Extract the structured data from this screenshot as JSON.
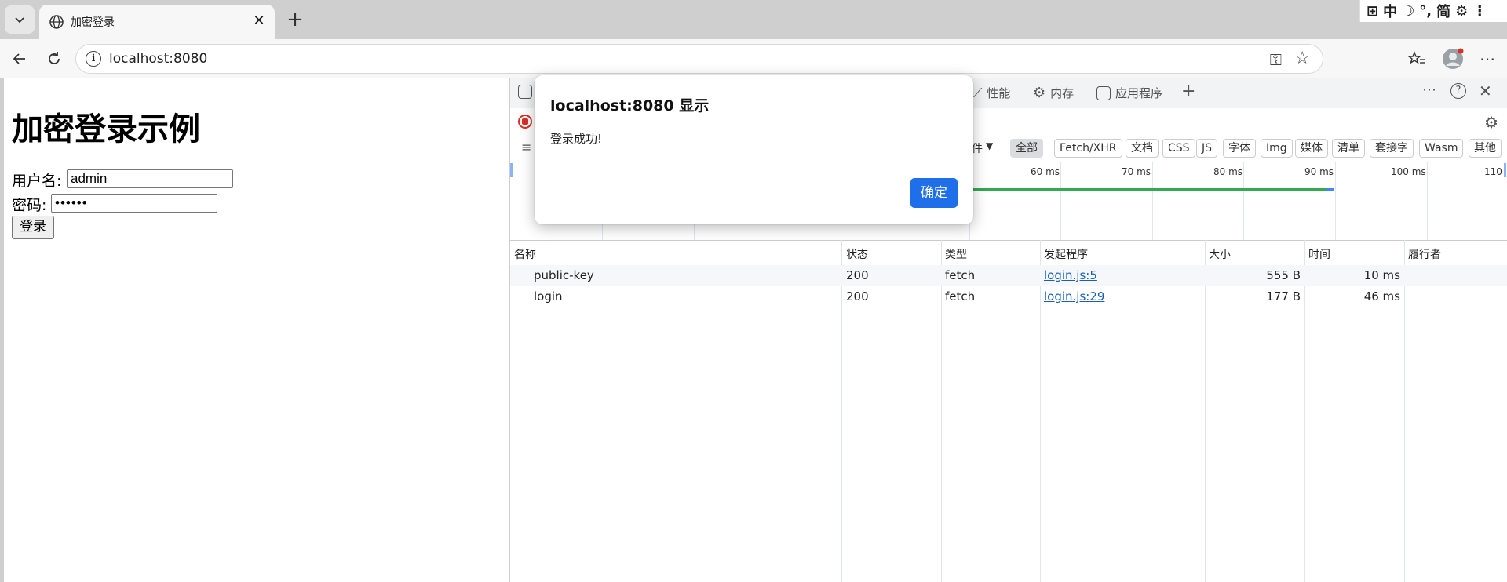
{
  "browser": {
    "tab": {
      "title": "加密登录"
    },
    "address": {
      "url": "localhost:8080"
    },
    "ime_indicator": [
      "中",
      "简"
    ]
  },
  "page": {
    "heading": "加密登录示例",
    "username_label": "用户名:",
    "username_value": "admin",
    "password_label": "密码:",
    "password_value": "••••••",
    "submit_label": "登录"
  },
  "devtools": {
    "tabs": [
      {
        "label": "性能"
      },
      {
        "label": "内存"
      },
      {
        "label": "应用程序"
      }
    ],
    "filters": [
      "全部",
      "Fetch/XHR",
      "文档",
      "CSS",
      "JS",
      "字体",
      "Img",
      "媒体",
      "清单",
      "套接字",
      "Wasm",
      "其他"
    ],
    "filter_active": "全部",
    "filter_partial": "件",
    "timeline_ticks": [
      "60 ms",
      "70 ms",
      "80 ms",
      "90 ms",
      "100 ms",
      "110"
    ],
    "columns": [
      "名称",
      "状态",
      "类型",
      "发起程序",
      "大小",
      "时间",
      "履行者"
    ],
    "rows": [
      {
        "name": "public-key",
        "status": "200",
        "type": "fetch",
        "initiator": "login.js:5",
        "size": "555 B",
        "time": "10 ms",
        "fulfilled_by": ""
      },
      {
        "name": "login",
        "status": "200",
        "type": "fetch",
        "initiator": "login.js:29",
        "size": "177 B",
        "time": "46 ms",
        "fulfilled_by": ""
      }
    ]
  },
  "dialog": {
    "title": "localhost:8080 显示",
    "message": "登录成功!",
    "ok_label": "确定"
  },
  "colors": {
    "primary_button": "#1f6feb",
    "link": "#1a5fb4",
    "record": "#d93025",
    "waterfall_green": "#34a853"
  }
}
